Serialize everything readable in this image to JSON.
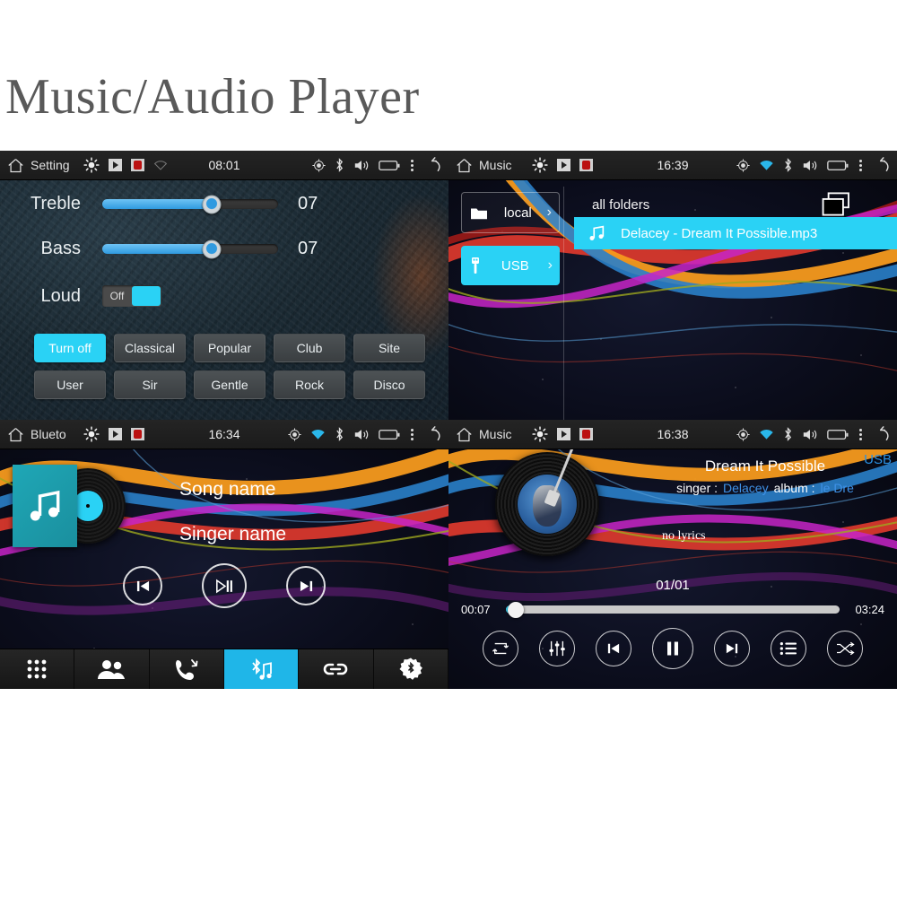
{
  "title": "Music/Audio Player",
  "panels": {
    "equalizer": {
      "statusbar": {
        "title": "Setting",
        "clock": "08:01"
      },
      "rows": [
        {
          "label": "Treble",
          "value": "07",
          "percent": 62
        },
        {
          "label": "Bass",
          "value": "07",
          "percent": 62
        }
      ],
      "loud": {
        "label": "Loud",
        "state": "Off"
      },
      "presets": [
        {
          "label": "Turn off",
          "active": true
        },
        {
          "label": "Classical",
          "active": false
        },
        {
          "label": "Popular",
          "active": false
        },
        {
          "label": "Club",
          "active": false
        },
        {
          "label": "Site",
          "active": false
        },
        {
          "label": "User",
          "active": false
        },
        {
          "label": "Sir",
          "active": false
        },
        {
          "label": "Gentle",
          "active": false
        },
        {
          "label": "Rock",
          "active": false
        },
        {
          "label": "Disco",
          "active": false
        }
      ]
    },
    "browser": {
      "statusbar": {
        "title": "Music",
        "clock": "16:39"
      },
      "sources": [
        {
          "label": "local",
          "active": false
        },
        {
          "label": "USB",
          "active": true
        }
      ],
      "folder_header": "all folders",
      "files": [
        {
          "name": "Delacey - Dream It Possible.mp3",
          "selected": true
        }
      ]
    },
    "bluetooth_music": {
      "statusbar": {
        "title": "Blueto",
        "clock": "16:34"
      },
      "song": "Song name",
      "singer": "Singer name",
      "controls": [
        "previous-track",
        "play-pause",
        "next-track"
      ],
      "navbar": [
        {
          "name": "dialpad",
          "active": false
        },
        {
          "name": "contacts",
          "active": false
        },
        {
          "name": "call-history",
          "active": false
        },
        {
          "name": "bluetooth-music",
          "active": true
        },
        {
          "name": "pair-link",
          "active": false
        },
        {
          "name": "bluetooth-settings",
          "active": false
        }
      ]
    },
    "now_playing": {
      "statusbar": {
        "title": "Music",
        "clock": "16:38"
      },
      "source_tag": "USB",
      "track_title": "Dream It Possible",
      "singer_label": "singer :",
      "singer_value": "Delacey",
      "album_label": "album :",
      "album_value": "le   Dre",
      "lyrics": "no lyrics",
      "track_index": "01/01",
      "elapsed": "00:07",
      "duration": "03:24",
      "progress_percent": 3,
      "controls": [
        "repeat",
        "equalizer",
        "previous-track",
        "pause",
        "next-track",
        "playlist",
        "shuffle"
      ]
    }
  },
  "colors": {
    "accent_cyan": "#2ad2f5",
    "title_gray": "#595959",
    "link_blue": "#3f92e8"
  }
}
